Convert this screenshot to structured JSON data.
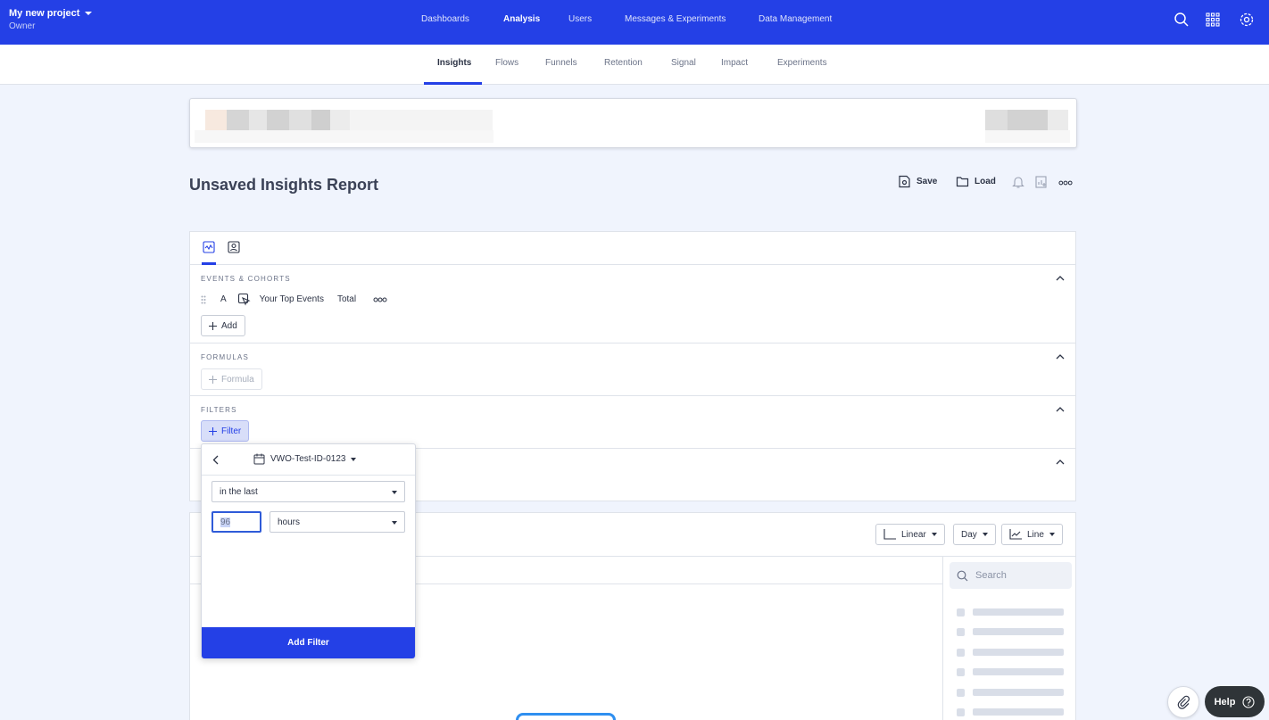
{
  "project": {
    "name": "My new project",
    "role": "Owner"
  },
  "topnav": [
    "Dashboards",
    "Analysis",
    "Users",
    "Messages & Experiments",
    "Data Management"
  ],
  "subnav": [
    "Insights",
    "Flows",
    "Funnels",
    "Retention",
    "Signal",
    "Impact",
    "Experiments"
  ],
  "report": {
    "title": "Unsaved Insights Report",
    "save_label": "Save",
    "load_label": "Load"
  },
  "sections": {
    "events": {
      "title": "EVENTS & COHORTS",
      "letter": "A",
      "event_label": "Your Top Events",
      "measure": "Total",
      "add_label": "Add"
    },
    "formulas": {
      "title": "FORMULAS",
      "add_label": "Formula"
    },
    "filters": {
      "title": "FILTERS",
      "add_label": "Filter"
    }
  },
  "popover": {
    "property": "VWO-Test-ID-0123",
    "operator": "in the last",
    "value": "96",
    "unit": "hours",
    "submit_label": "Add Filter"
  },
  "chart_controls": {
    "scale": "Linear",
    "interval": "Day",
    "chart_type": "Line"
  },
  "legend": {
    "search_placeholder": "Search"
  },
  "help": {
    "label": "Help"
  },
  "colors": {
    "brand": "#2440e6",
    "background": "#f0f4fd"
  }
}
